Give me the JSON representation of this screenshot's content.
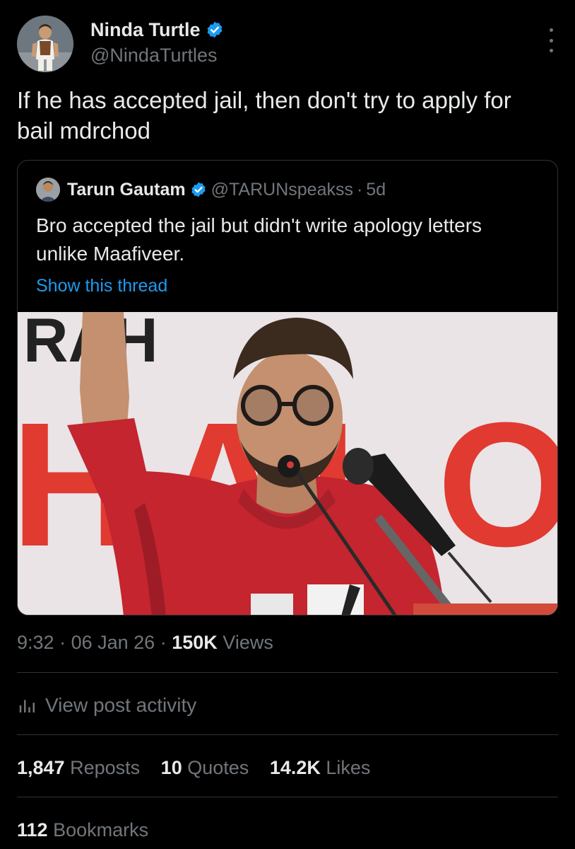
{
  "author": {
    "display_name": "Ninda Turtle",
    "handle": "@NindaTurtles",
    "verified": true
  },
  "tweet": {
    "text": "If he has accepted jail, then don't try to apply for bail mdrchod"
  },
  "quoted_tweet": {
    "display_name": "Tarun Gautam",
    "handle": "@TARUNspeakss",
    "separator": "·",
    "age": "5d",
    "verified": true,
    "text": "Bro accepted the jail but didn't write apology letters unlike Maafiveer.",
    "show_thread_label": "Show this thread",
    "banner_letters_top": "RAH",
    "banner_letters_mid": "HALO"
  },
  "meta": {
    "time": "9:32",
    "sep1": "·",
    "date": "06 Jan 26",
    "sep2": "·",
    "views_count": "150K",
    "views_label": "Views"
  },
  "activity": {
    "label": "View post activity",
    "icon": "bar-chart-icon"
  },
  "stats": {
    "reposts_count": "1,847",
    "reposts_label": "Reposts",
    "quotes_count": "10",
    "quotes_label": "Quotes",
    "likes_count": "14.2K",
    "likes_label": "Likes",
    "bookmarks_count": "112",
    "bookmarks_label": "Bookmarks"
  },
  "colors": {
    "background": "#000000",
    "text_primary": "#e7e9ea",
    "text_secondary": "#71767b",
    "link": "#1d9bf0",
    "verified": "#1d9bf0",
    "divider": "#2f3336",
    "banner_red": "#e0281e",
    "shirt_red": "#c4252f"
  }
}
